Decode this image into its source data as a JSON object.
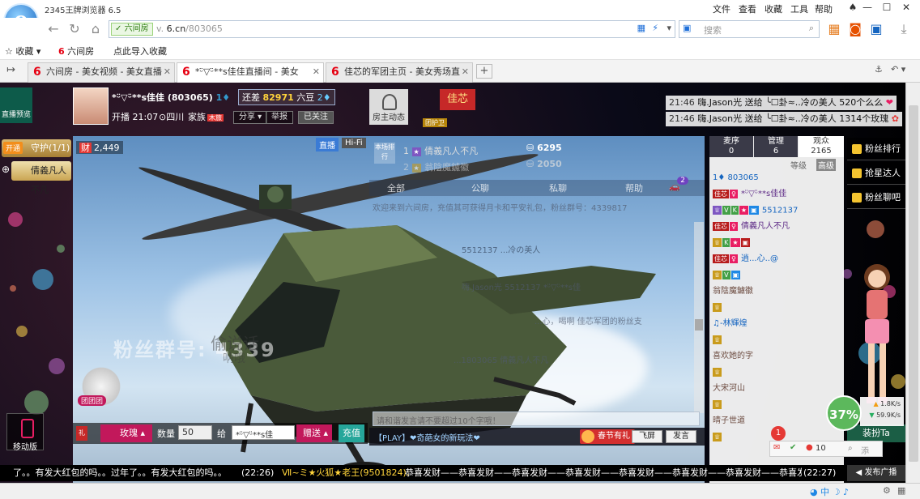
{
  "browser": {
    "app_title": "2345王牌浏览器 6.5",
    "menu": [
      "文件",
      "查看",
      "收藏",
      "工具",
      "帮助"
    ],
    "secure_label": "六间房",
    "url_prefix": "v.",
    "url_domain": "6.cn",
    "url_path": "/803065",
    "search_placeholder": "搜索",
    "bookmarks": [
      "收藏",
      "六间房",
      "点此导入收藏"
    ],
    "tabs": [
      {
        "title": "六间房 - 美女视频 - 美女直播",
        "active": false
      },
      {
        "title": "*ᵕ̈▽ᵕ̈**s佳佳直播间 - 美女",
        "active": true
      },
      {
        "title": "佳芯的军团主页 - 美女秀场直",
        "active": false
      }
    ]
  },
  "room": {
    "preview_label": "直播预览",
    "anchor_name": "*ᵕ̈▽ᵕ̈**s佳佳 (803065)",
    "gap_text": "还差",
    "gap_value": "82971",
    "gap_unit": "六豆",
    "live_time": "开播 21:07",
    "location": "四川",
    "family": "家族",
    "family_tag": "木旅",
    "share": "分享",
    "report": "举报",
    "followed": "已关注",
    "host_dynamic": "房主动态",
    "legion_flag": "佳芯",
    "legion_badge": "团护卫",
    "gift_feed": [
      {
        "time": "21:46",
        "text": "嗨.Jason光 送给 ╰☐卦≈..冷の美人 520个么么"
      },
      {
        "time": "21:46",
        "text": "嗨.Jason光 送给 ╰☐卦≈..冷の美人 1314个玫瑰"
      }
    ]
  },
  "guard": {
    "open_badge": "开通",
    "title": "守护(1/1)",
    "member": "倩義凡人不凡",
    "mobile_label": "移动版"
  },
  "video": {
    "viewer_tag": "财",
    "viewers": "2,449",
    "live_label": "直播",
    "hifi_label": "Hi-Fi",
    "fans_no": "粉丝群号: 4339",
    "bubble1": "偷说话",
    "bubble2": "呐哦",
    "bear_tag": "团团团"
  },
  "rank": {
    "badge": "本场排行",
    "row1_rank": "1",
    "row1_name": "倩義凡人不凡",
    "row1_score": "6295",
    "row2_rank": "2",
    "row2_name": "翁陰魔鑢徽",
    "row2_score": "2050"
  },
  "chat": {
    "tabs": [
      "全部",
      "公聊",
      "私聊",
      "帮助"
    ],
    "tab_badge": "2",
    "lines": [
      "欢迎来到六间房，充值其可获得月卡和平安礼包，粉丝群号：4339817",
      "5512137 ...冷の美人",
      "嗨.Jason光 5512137 *ᵕ̈▽ᵕ̈**s佳",
      "...心，喝啊 佳芯军团的粉丝支",
      "...1803065 倩義凡人不凡"
    ],
    "input_placeholder": "请和谐发言请不要超过10个字哦！",
    "play_tip": "【PLAY】❤奇葩女的新玩法❤",
    "spring": "春节有礼",
    "flyscreen": "飞屏",
    "send": "发言"
  },
  "gifts": {
    "gift_name": "玫瑰",
    "qty_label": "数量",
    "qty": "50",
    "to_label": "给",
    "to_name": "*ᵕ̈▽ᵕ̈**s佳",
    "give": "赠送",
    "recharge": "充值"
  },
  "users": {
    "tabs": [
      {
        "label": "麦序",
        "count": "0"
      },
      {
        "label": "管理",
        "count": "6"
      },
      {
        "label": "观众",
        "count": "2165"
      }
    ],
    "level_label": "等级",
    "level_tag": "高级",
    "list": [
      {
        "id": "803065",
        "name": "*ᵕ̈▽ᵕ̈**s佳佳",
        "tag": "佳芯"
      },
      {
        "id": "5512137",
        "name": "倩義凡人不凡",
        "tag": "佳芯"
      },
      {
        "name": "逍...心..@",
        "tag": "佳芯"
      },
      {
        "name": "翁陰魔鑢徽"
      },
      {
        "name": "♫-林輝煌"
      },
      {
        "name": "喜欢她的字"
      },
      {
        "name": "大宋河山"
      },
      {
        "name": "晴子世道"
      }
    ]
  },
  "side": {
    "rank_buttons": [
      "粉丝排行",
      "抢星达人",
      "粉丝聊吧"
    ],
    "dress_button": "装扮Ta",
    "gauge": "37%",
    "speed_up": "1.8K/s",
    "speed_down": "59.9K/s",
    "notify_count": "1",
    "notify_users": "10",
    "notify_more": "添"
  },
  "ticker": {
    "left_text": "了。。有发大红包的吗。。过年了。。有发大红包的吗。。",
    "left_time": "(22:26)",
    "right_name": "Ⅶ~ミ★火狐★老王(9501824):",
    "right_text": "恭喜发财——恭喜发财——恭喜发财——恭喜发财——恭喜发财——恭喜发财——恭喜发财——恭喜发财——",
    "right_time": "(22:27)",
    "broadcast": "发布广播"
  }
}
